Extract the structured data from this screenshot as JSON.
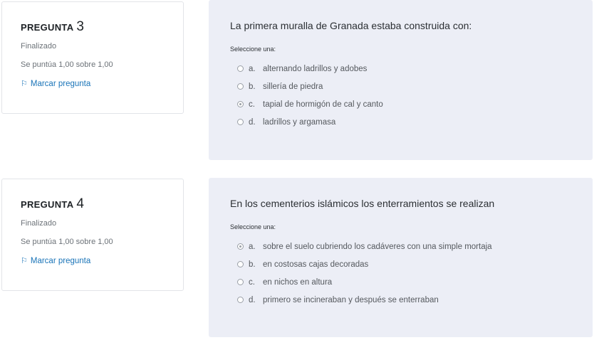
{
  "questions": [
    {
      "label": "PREGUNTA",
      "number": "3",
      "state": "Finalizado",
      "score": "Se puntúa 1,00 sobre 1,00",
      "flag_label": "Marcar pregunta",
      "text": "La primera muralla de Granada estaba construida con:",
      "prompt": "Seleccione una:",
      "answers": [
        {
          "letter": "a.",
          "text": "alternando ladrillos y adobes",
          "checked": false
        },
        {
          "letter": "b.",
          "text": "sillería de piedra",
          "checked": false
        },
        {
          "letter": "c.",
          "text": "tapial de hormigón de cal y canto",
          "checked": true
        },
        {
          "letter": "d.",
          "text": "ladrillos y argamasa",
          "checked": false
        }
      ]
    },
    {
      "label": "PREGUNTA",
      "number": "4",
      "state": "Finalizado",
      "score": "Se puntúa 1,00 sobre 1,00",
      "flag_label": "Marcar pregunta",
      "text": "En los cementerios islámicos los enterramientos se realizan",
      "prompt": "Seleccione una:",
      "answers": [
        {
          "letter": "a.",
          "text": "sobre el suelo cubriendo los cadáveres con una simple mortaja",
          "checked": true
        },
        {
          "letter": "b.",
          "text": "en costosas cajas decoradas",
          "checked": false
        },
        {
          "letter": "c.",
          "text": "en nichos en altura",
          "checked": false
        },
        {
          "letter": "d.",
          "text": "primero se incineraban y después se enterraban",
          "checked": false
        }
      ]
    }
  ]
}
